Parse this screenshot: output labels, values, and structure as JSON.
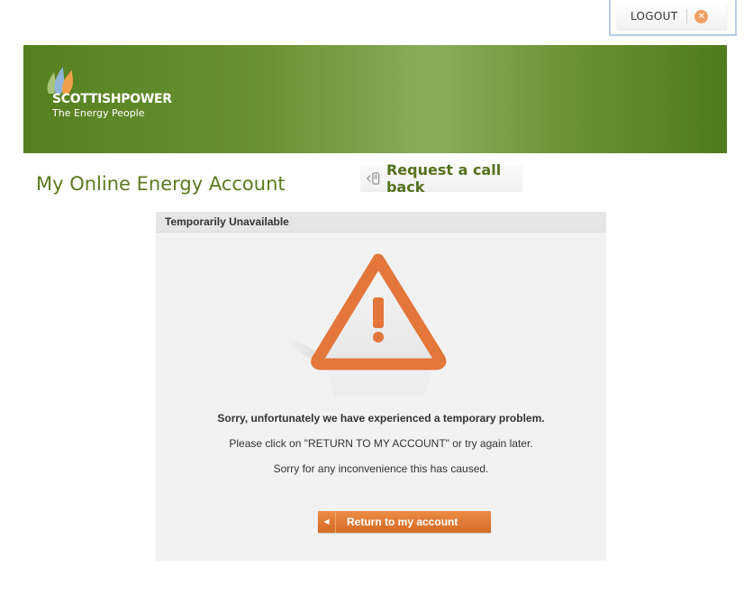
{
  "header": {
    "logout_label": "LOGOUT",
    "logout_icon": "close-circle-icon"
  },
  "banner": {
    "brand_name": "SCOTTISHPOWER",
    "tagline": "The Energy People",
    "logo_icon": "flame-leaves-icon"
  },
  "page": {
    "title": "My Online Energy Account",
    "callback_label": "Request a call back",
    "callback_icon": "phone-arrows-icon"
  },
  "panel": {
    "header_title": "Temporarily Unavailable",
    "warning_icon": "warning-triangle-icon",
    "message_primary": "Sorry, unfortunately we have experienced a temporary problem.",
    "message_secondary": "Please click on \"RETURN TO MY ACCOUNT\" or try again later.",
    "message_tertiary": "Sorry for any inconvenience this has caused.",
    "return_label": "Return to my account"
  },
  "colors": {
    "brand_green": "#5c7a1e",
    "accent_orange": "#e07a32",
    "panel_bg": "#f2f2f2"
  }
}
